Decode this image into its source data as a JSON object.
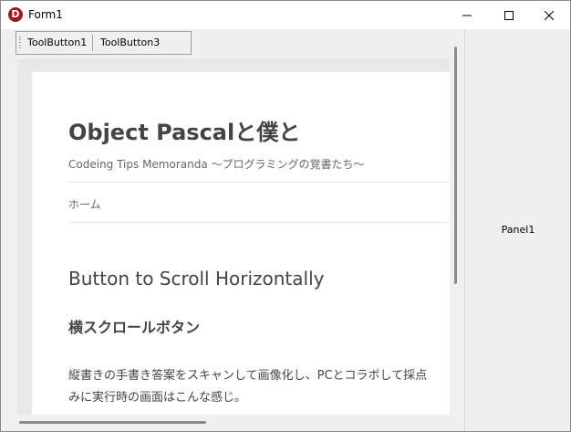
{
  "window": {
    "title": "Form1",
    "app_icon": "D"
  },
  "toolbar": {
    "buttons": [
      "ToolButton1",
      "ToolButton3"
    ]
  },
  "browser": {
    "site_title": "Object Pascalと僕と",
    "tagline": "Codeing Tips Memoranda ～プログラミングの覚書たち～",
    "nav": [
      "ホーム"
    ],
    "post_title": "Button to Scroll Horizontally",
    "post_subtitle": "横スクロールボタン",
    "body_lines": [
      "縦書きの手書き答案をスキャンして画像化し、PCとコラボして採点",
      "みに実行時の画面はこんな感じ。"
    ]
  },
  "panel": {
    "caption": "Panel1"
  }
}
